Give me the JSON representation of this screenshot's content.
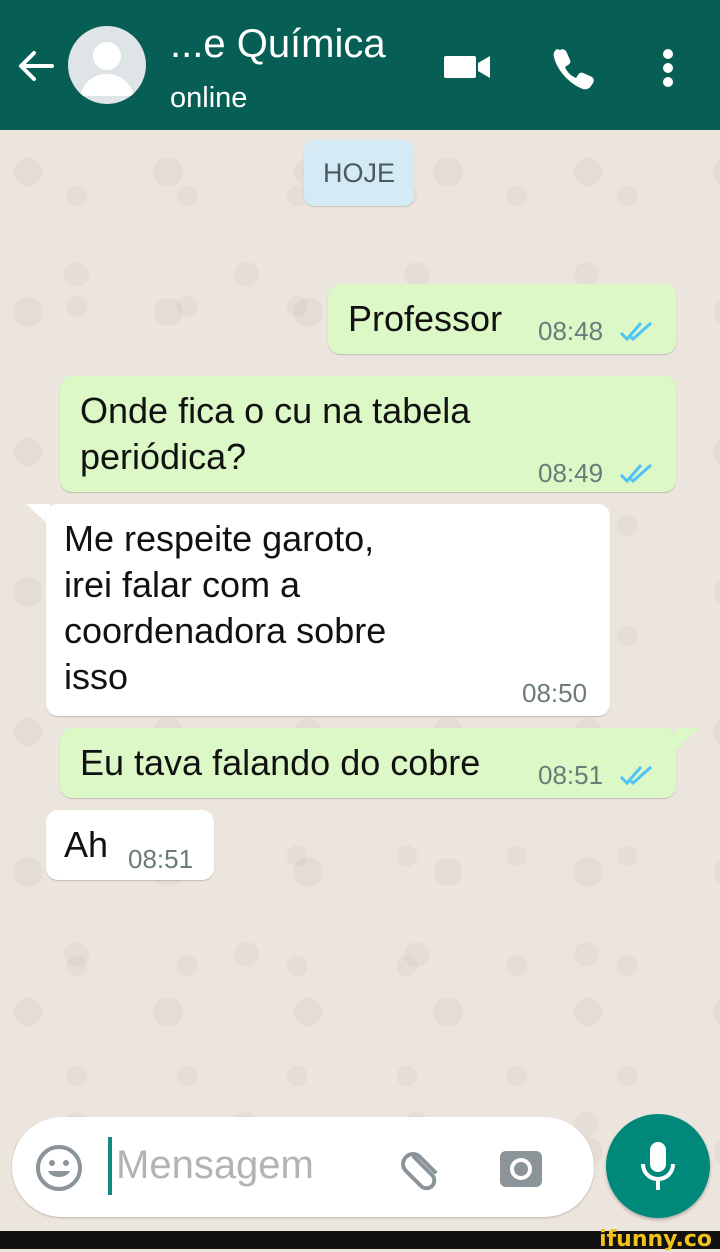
{
  "header": {
    "title": "...e Química",
    "status": "online"
  },
  "chat": {
    "date_label": "HOJE",
    "messages": [
      {
        "direction": "out",
        "text": "Professor",
        "time": "08:48",
        "read": true
      },
      {
        "direction": "out",
        "lines": [
          "Onde fica o cu na tabela",
          "periódica?"
        ],
        "time": "08:49",
        "read": true
      },
      {
        "direction": "in",
        "lines": [
          "Me respeite garoto,",
          "irei falar com a",
          "coordenadora sobre",
          "isso"
        ],
        "time": "08:50"
      },
      {
        "direction": "out",
        "text": "Eu tava falando do cobre",
        "time": "08:51",
        "read": true
      },
      {
        "direction": "in",
        "text": "Ah",
        "time": "08:51"
      }
    ]
  },
  "composer": {
    "placeholder": "Mensagem"
  },
  "watermark": "ifunny.co",
  "colors": {
    "header": "#075e54",
    "outgoing": "#dcf8c6",
    "incoming": "#ffffff",
    "read_tick": "#4fc3f7",
    "mic_button": "#00897b"
  }
}
